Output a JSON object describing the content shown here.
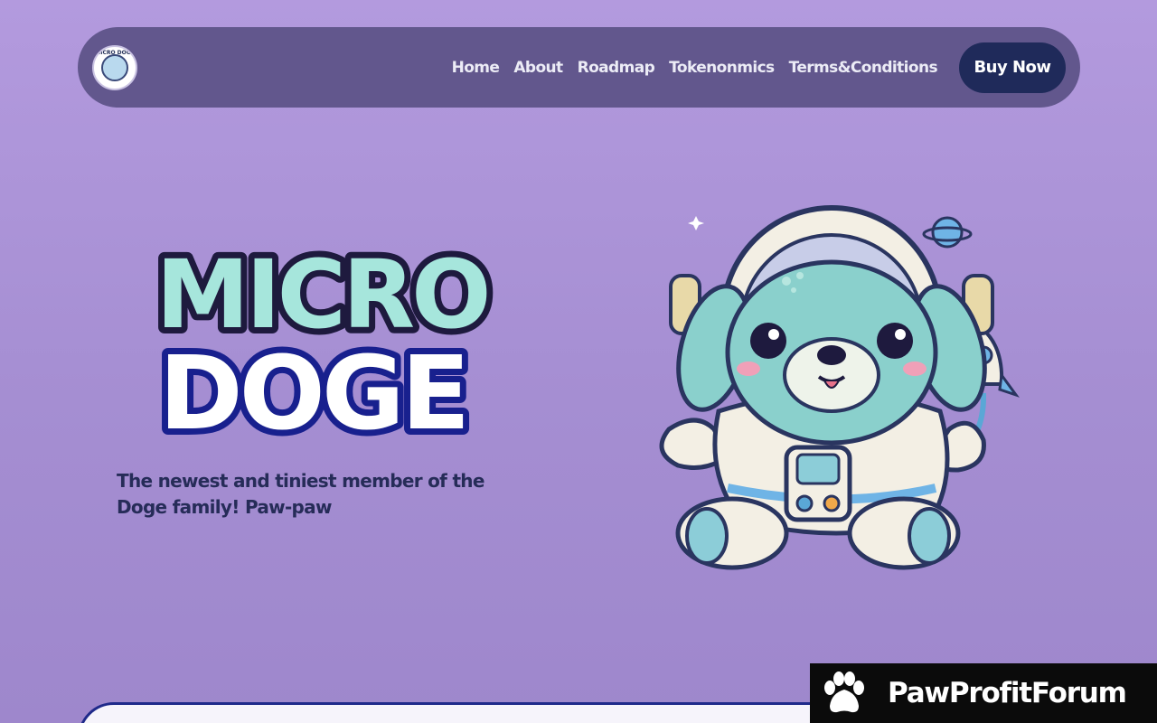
{
  "brand": {
    "logo_text": "MICRO DOGE"
  },
  "nav": {
    "items": [
      {
        "label": "Home"
      },
      {
        "label": "About"
      },
      {
        "label": "Roadmap"
      },
      {
        "label": "Tokenonmics"
      },
      {
        "label": "Terms&Conditions"
      }
    ],
    "buy_label": "Buy Now"
  },
  "hero": {
    "title_line1": "MICRO",
    "title_line2": "DOGE",
    "tagline": "The newest and tiniest member of the Doge family! Paw-paw"
  },
  "watermark": {
    "text": "PawProfitForum"
  },
  "colors": {
    "background": "#b39ade",
    "nav_bg": "#62578d",
    "button_bg": "#1f2a5a",
    "title_teal": "#a6e6dc",
    "title_white": "#ffffff",
    "tagline": "#262c58"
  }
}
